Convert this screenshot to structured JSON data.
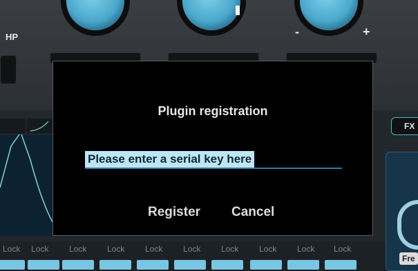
{
  "background": {
    "hp_label": "HP",
    "minus_label": "-",
    "plus_label": "+",
    "fx_label": "FX",
    "fre_label": "Fre",
    "lock_labels": [
      "Lock",
      "Lock",
      "Lock",
      "Lock",
      "Lock",
      "Lock",
      "Lock",
      "Lock",
      "Lock",
      "Lock"
    ]
  },
  "dialog": {
    "title": "Plugin registration",
    "serial_placeholder": "Please enter a serial key here",
    "register_label": "Register",
    "cancel_label": "Cancel"
  },
  "colors": {
    "accent": "#4db7d9",
    "modal_bg": "#000000",
    "text": "#e6e6e6"
  }
}
